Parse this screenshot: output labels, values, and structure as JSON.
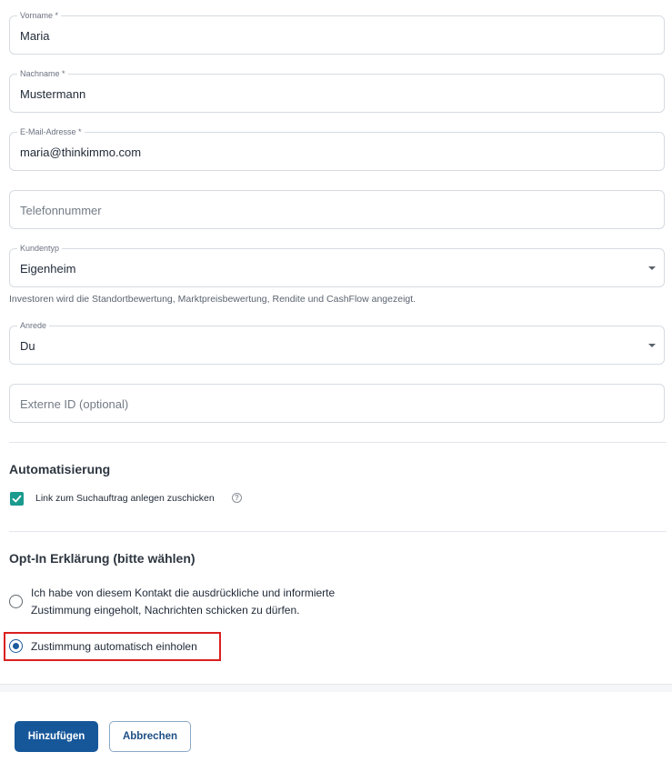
{
  "form": {
    "vorname": {
      "label": "Vorname *",
      "value": "Maria"
    },
    "nachname": {
      "label": "Nachname *",
      "value": "Mustermann"
    },
    "email": {
      "label": "E-Mail-Adresse *",
      "value": "maria@thinkimmo.com"
    },
    "telefon": {
      "placeholder": "Telefonnummer"
    },
    "kundentyp": {
      "label": "Kundentyp",
      "value": "Eigenheim",
      "helper": "Investoren wird die Standortbewertung, Marktpreisbewertung, Rendite und CashFlow angezeigt."
    },
    "anrede": {
      "label": "Anrede",
      "value": "Du"
    },
    "externe_id": {
      "placeholder": "Externe ID (optional)"
    }
  },
  "automatisierung": {
    "title": "Automatisierung",
    "checkbox_label": "Link zum Suchauftrag anlegen zuschicken",
    "checked": true,
    "help_icon": "question-circle-icon"
  },
  "opt_in": {
    "title": "Opt-In Erklärung (bitte wählen)",
    "options": [
      {
        "label_line1": "Ich habe von diesem Kontakt die ausdrückliche und informierte",
        "label_line2": "Zustimmung eingeholt, Nachrichten schicken zu dürfen.",
        "selected": false
      },
      {
        "label": "Zustimmung automatisch einholen",
        "selected": true
      }
    ]
  },
  "actions": {
    "add_label": "Hinzufügen",
    "cancel_label": "Abbrechen"
  },
  "colors": {
    "primary": "#16579a",
    "checkbox": "#1b9a8e",
    "highlight": "#d9201f"
  }
}
